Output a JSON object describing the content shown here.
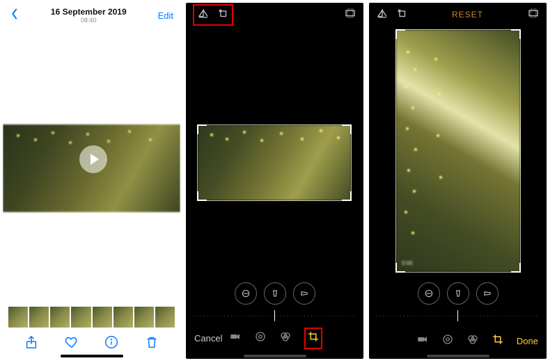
{
  "panel1": {
    "date": "16 September 2019",
    "time": "08:40",
    "edit": "Edit"
  },
  "panel2": {
    "cancel": "Cancel"
  },
  "panel3": {
    "reset": "RESET",
    "done": "Done",
    "timestamp": "0:00"
  }
}
